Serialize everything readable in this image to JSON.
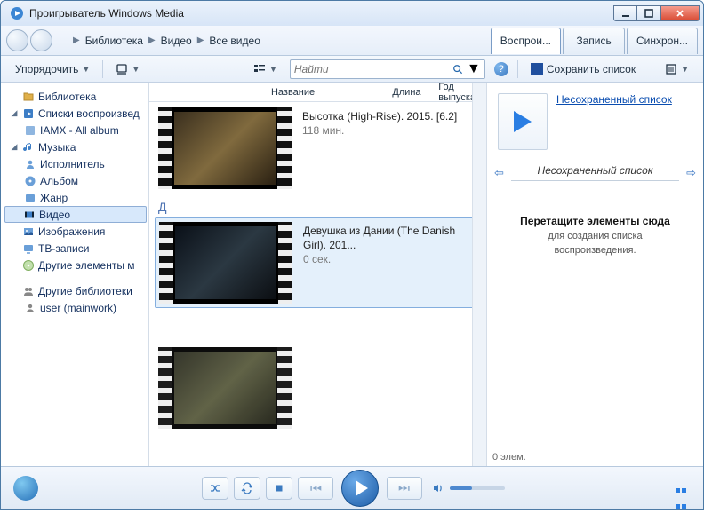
{
  "title": "Проигрыватель Windows Media",
  "breadcrumb": {
    "a": "Библиотека",
    "b": "Видео",
    "c": "Все видео"
  },
  "rtabs": {
    "play": "Воспрои...",
    "burn": "Запись",
    "sync": "Синхрон..."
  },
  "toolbar": {
    "organize": "Упорядочить",
    "viewmode": "",
    "search_placeholder": "Найти",
    "save_list": "Сохранить список"
  },
  "columns": {
    "name": "Название",
    "length": "Длина",
    "year": "Год выпуска"
  },
  "sidebar": {
    "library": "Библиотека",
    "playlists": "Списки воспроизвед",
    "iamx": "IAMX - All album",
    "music": "Музыка",
    "artist": "Исполнитель",
    "album": "Альбом",
    "genre": "Жанр",
    "video": "Видео",
    "images": "Изображения",
    "tvrec": "ТВ-записи",
    "other_media": "Другие элементы м",
    "other_libs": "Другие библиотеки",
    "user": "user (mainwork)"
  },
  "videos": {
    "v1": {
      "title": "Высотка (High-Rise). 2015. [6.2]",
      "duration": "118 мин."
    },
    "group_d": "Д",
    "v2": {
      "title": "Девушка из Дании (The Danish Girl). 201...",
      "duration": "0 сек."
    }
  },
  "playlist": {
    "unsaved_link": "Несохраненный список",
    "nav_title": "Несохраненный список",
    "drag_title": "Перетащите элементы сюда",
    "drag_sub1": "для создания списка",
    "drag_sub2": "воспроизведения.",
    "footer": "0 элем."
  }
}
